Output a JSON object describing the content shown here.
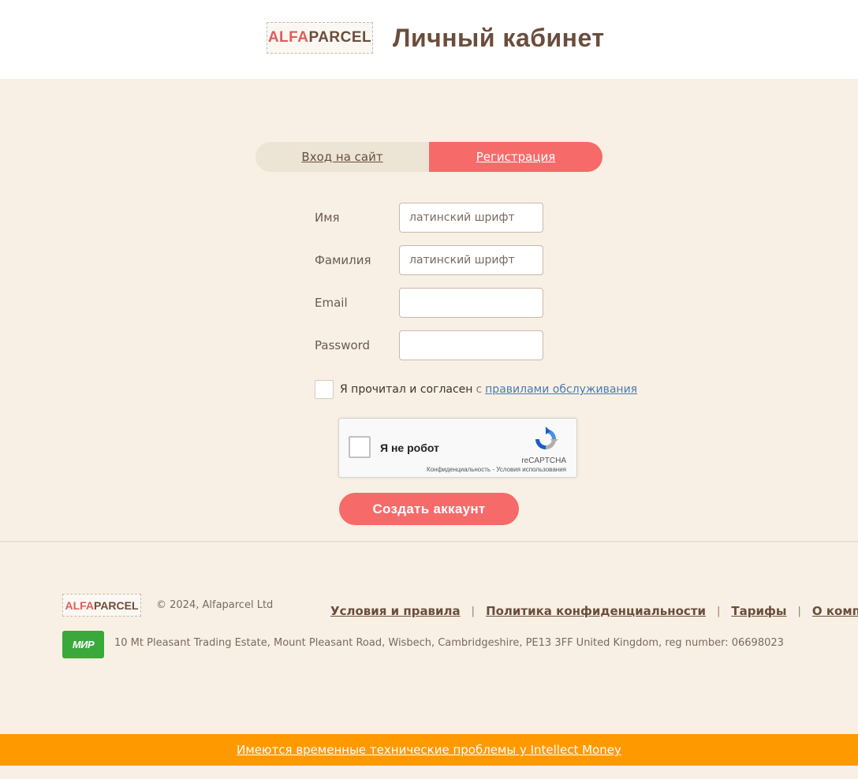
{
  "header": {
    "logo_part1": "ALFA",
    "logo_part2": "PARCEL",
    "title": "Личный кабинет"
  },
  "tabs": {
    "login_label": "Вход на сайт",
    "register_label": "Регистрация",
    "active": "register"
  },
  "form": {
    "fields": [
      {
        "label": "Имя",
        "placeholder": "латинский шрифт",
        "value": ""
      },
      {
        "label": "Фамилия",
        "placeholder": "латинский шрифт",
        "value": ""
      },
      {
        "label": "Email",
        "placeholder": "",
        "value": ""
      },
      {
        "label": "Password",
        "placeholder": "",
        "value": ""
      }
    ],
    "agree_strong": "Я прочитал и согласен",
    "agree_light": "с",
    "agree_link": "правилами обслуживания",
    "agree_checked": false,
    "submit_label": "Создать аккаунт"
  },
  "captcha": {
    "label": "Я не робот",
    "brand": "reCAPTCHA",
    "privacy": "Конфиденциальность",
    "sep": " - ",
    "terms": "Условия использования"
  },
  "footer": {
    "logo_part1": "ALFA",
    "logo_part2": "PARCEL",
    "copyright": "© 2024, Alfaparcel Ltd",
    "links": [
      "Условия и правила",
      "Политика конфиденциальности",
      "Тарифы",
      "О компании"
    ],
    "separator": "|",
    "payment_badge": "МИР",
    "address": "10 Mt Pleasant Trading Estate, Mount Pleasant Road, Wisbech, Cambridgeshire, PE13 3FF United Kingdom, reg number: 06698023"
  },
  "notice": {
    "text": "Имеются временные технические проблемы у Intellect Money"
  },
  "colors": {
    "accent": "#f76a6a",
    "brown": "#6b4d3c",
    "background": "#f8f0e4",
    "notice": "#ff9900",
    "mir_green": "#3aa83a"
  }
}
